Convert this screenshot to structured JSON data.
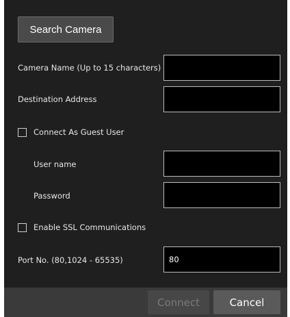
{
  "dialog": {
    "search_button": "Search Camera",
    "camera_name": {
      "label": "Camera Name  (Up to 15 characters)",
      "value": ""
    },
    "destination_address": {
      "label": "Destination Address",
      "value": ""
    },
    "guest_user": {
      "label": "Connect As Guest User",
      "checked": false
    },
    "user_name": {
      "label": "User name",
      "value": ""
    },
    "password": {
      "label": "Password",
      "value": ""
    },
    "ssl": {
      "label": "Enable SSL Communications",
      "checked": false
    },
    "port": {
      "label": "Port No. (80,1024 - 65535)",
      "value": "80"
    },
    "connect_button": "Connect",
    "cancel_button": "Cancel"
  },
  "colors": {
    "dialog_background": "#1f1f1f",
    "footer_background": "#3a3a3a",
    "field_background": "#000000",
    "field_border": "#bdbdbd",
    "disabled_text": "#7a7a7a"
  }
}
